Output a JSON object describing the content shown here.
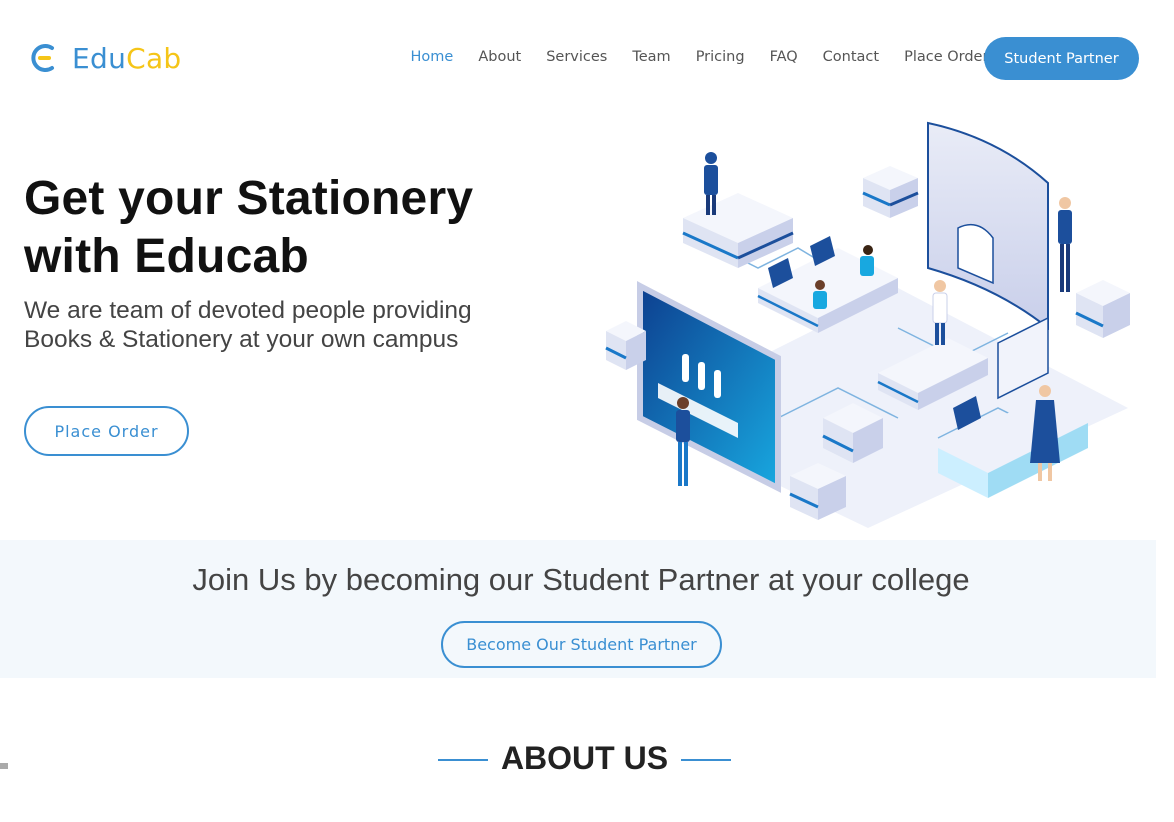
{
  "brand": {
    "name_part1": "Edu",
    "name_part2": "Cab",
    "primary": "#3a8fd2",
    "accent": "#f5c518"
  },
  "nav": {
    "items": [
      {
        "label": "Home",
        "active": true
      },
      {
        "label": "About"
      },
      {
        "label": "Services"
      },
      {
        "label": "Team"
      },
      {
        "label": "Pricing"
      },
      {
        "label": "FAQ"
      },
      {
        "label": "Contact"
      },
      {
        "label": "Place Order"
      }
    ],
    "cta_label": "Student Partner"
  },
  "hero": {
    "title_line1": "Get your Stationery",
    "title_line2": "with Educab",
    "subtitle_line1": "We are team of devoted people providing",
    "subtitle_line2": "Books & Stationery at your own campus",
    "button_label": "Place Order"
  },
  "join": {
    "title": "Join Us by becoming our Student Partner at your college",
    "button_label": "Become Our Student Partner"
  },
  "about": {
    "title": "ABOUT US"
  }
}
